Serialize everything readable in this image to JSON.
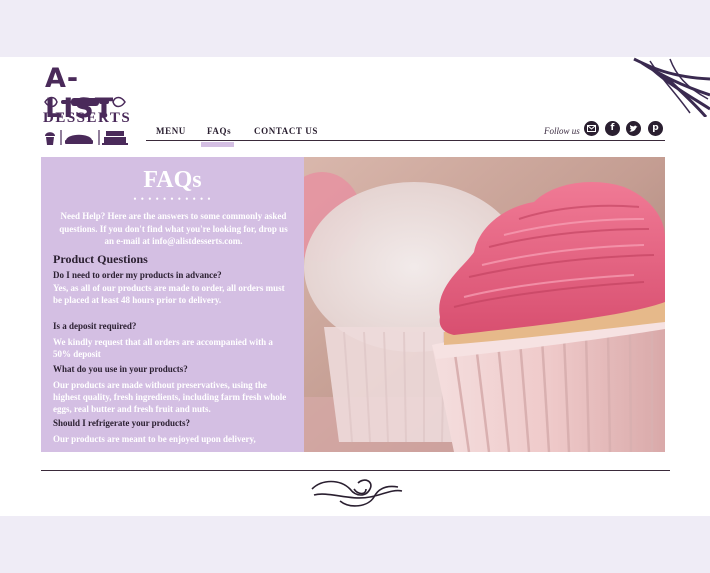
{
  "brand": {
    "line1": "A-LIST",
    "line2": "DESSERTS"
  },
  "nav": {
    "items": [
      "MENU",
      "FAQs",
      "CONTACT US"
    ],
    "active": "FAQs"
  },
  "social": {
    "follow_label": "Follow us",
    "icons": [
      "mail-icon",
      "facebook-icon",
      "twitter-icon",
      "pinterest-icon"
    ]
  },
  "faq": {
    "title": "FAQs",
    "dots": "• • • • • • • • • • •",
    "intro": "Need Help? Here are the answers to some commonly asked questions.  If you don't find what you're looking for, drop us an e-mail at info@alistdesserts.com.",
    "section_heading": "Product Questions",
    "items": [
      {
        "q": "Do I need to order my products in advance?",
        "a": "Yes, as all of our products are made to order, all orders must be placed at least 48 hours prior to delivery."
      },
      {
        "q": "Is a deposit required?",
        "a": "We kindly request that all orders are accompanied with a 50% deposit"
      },
      {
        "q": "What do you use in your products?",
        "a": "Our products are made without preservatives, using the highest quality, fresh ingredients, including farm fresh whole eggs, real butter and fresh fruit and nuts."
      },
      {
        "q": "Should I refrigerate your products?",
        "a": "Our products are meant to be enjoyed upon delivery,"
      }
    ]
  },
  "colors": {
    "panel": "#d4bfe3",
    "brand": "#4a2a5a",
    "frosting": "#e9607f"
  }
}
